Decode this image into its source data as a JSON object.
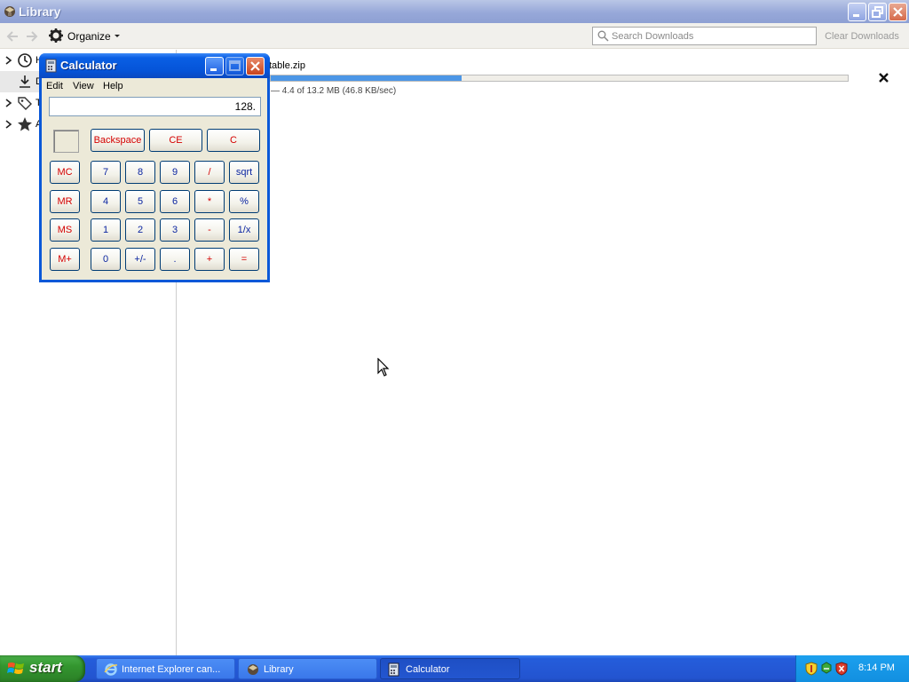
{
  "library": {
    "title": "Library",
    "toolbar": {
      "organize_label": "Organize",
      "search_placeholder": "Search Downloads",
      "clear_downloads_label": "Clear Downloads"
    },
    "sidebar": {
      "items": [
        {
          "label": "H",
          "icon": "clock-icon"
        },
        {
          "label": "D",
          "icon": "download-icon"
        },
        {
          "label": "T",
          "icon": "tag-icon"
        },
        {
          "label": "A",
          "icon": "star-icon"
        }
      ]
    },
    "download": {
      "filename": "table.zip",
      "status": "— 4.4 of 13.2 MB (46.8 KB/sec)",
      "progress_fraction": 0.33
    }
  },
  "calculator": {
    "title": "Calculator",
    "menu": [
      "Edit",
      "View",
      "Help"
    ],
    "display": "128.",
    "buttons": {
      "backspace": "Backspace",
      "ce": "CE",
      "c": "C",
      "mc": "MC",
      "mr": "MR",
      "ms": "MS",
      "mplus": "M+",
      "d7": "7",
      "d8": "8",
      "d9": "9",
      "div": "/",
      "sqrt": "sqrt",
      "d4": "4",
      "d5": "5",
      "d6": "6",
      "mul": "*",
      "pct": "%",
      "d1": "1",
      "d2": "2",
      "d3": "3",
      "sub": "-",
      "inv": "1/x",
      "d0": "0",
      "sign": "+/-",
      "dot": ".",
      "add": "+",
      "eq": "="
    }
  },
  "taskbar": {
    "start_label": "start",
    "tasks": [
      {
        "label": "Internet Explorer can...",
        "icon": "ie-icon"
      },
      {
        "label": "Library",
        "icon": "library-icon"
      },
      {
        "label": "Calculator",
        "icon": "calculator-icon"
      }
    ],
    "clock": "8:14 PM"
  }
}
